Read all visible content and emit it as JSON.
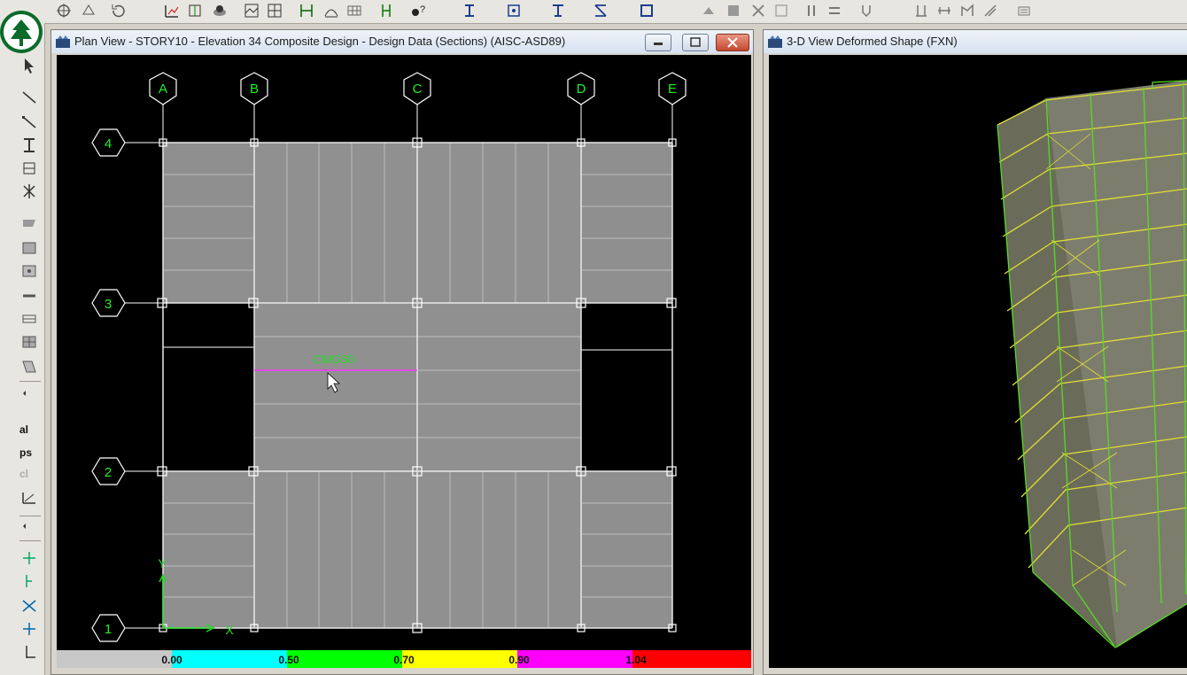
{
  "plan_window": {
    "title": "Plan View - STORY10 - Elevation 34  Composite Design - Design Data (Sections)  (AISC-ASD89)",
    "grid_x": [
      "A",
      "B",
      "C",
      "D",
      "E"
    ],
    "grid_y": [
      "4",
      "3",
      "2",
      "1"
    ],
    "beam_label": "CMGS0",
    "axis_x": "X",
    "axis_y": "Y",
    "legend": [
      "0.00",
      "0.50",
      "0.70",
      "0.90",
      "1.04"
    ],
    "legend_colors": [
      "#c8c8c8",
      "#00ffff",
      "#00ff00",
      "#ffff00",
      "#ff00ff",
      "#ff0000"
    ]
  },
  "view3d_window": {
    "title": "3-D View  Deformed Shape (FXN)"
  },
  "left_toolbar": {
    "text_buttons": [
      "al",
      "ps",
      "cl"
    ]
  },
  "icons": [
    "app-logo-icon",
    "select-pointer-icon",
    "draw-line-icon",
    "section-icon",
    "area-icon",
    "grid-icon",
    "move-icon",
    "snap-icon",
    "zoom-icon",
    "pan-icon",
    "minimize-icon",
    "maximize-icon",
    "close-icon"
  ]
}
